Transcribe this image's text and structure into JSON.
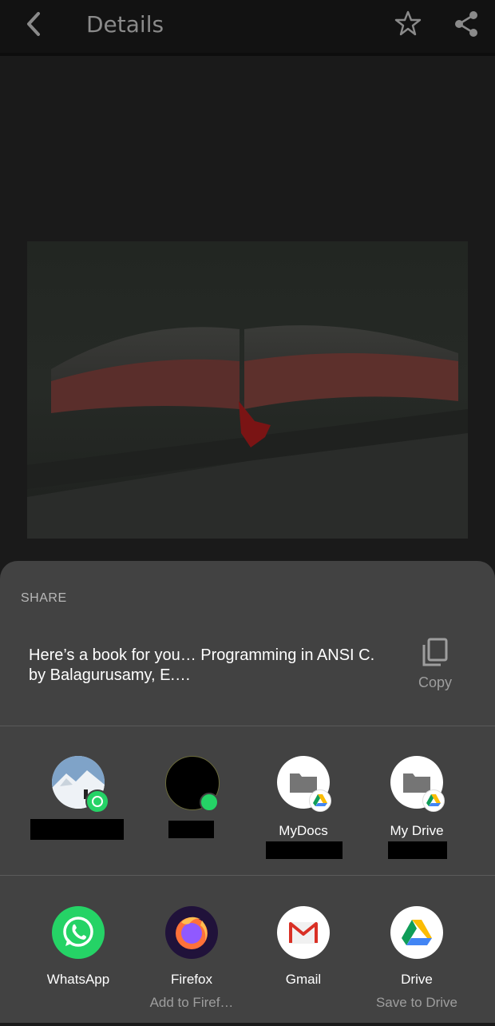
{
  "toolbar": {
    "title": "Details"
  },
  "share": {
    "label": "SHARE",
    "text": "Here’s a book for you… Programming in ANSI C. by Balagurusamy, E.…",
    "copy_label": "Copy"
  },
  "direct_targets": [
    {
      "label": ""
    },
    {
      "label": ""
    },
    {
      "label": "MyDocs"
    },
    {
      "label": "My Drive"
    }
  ],
  "apps": [
    {
      "label": "WhatsApp",
      "sub": ""
    },
    {
      "label": "Firefox",
      "sub": "Add to Firef…"
    },
    {
      "label": "Gmail",
      "sub": ""
    },
    {
      "label": "Drive",
      "sub": "Save to Drive"
    }
  ],
  "colors": {
    "sheet": "#424242",
    "whatsapp": "#25D366",
    "drive_yellow": "#FBBC04",
    "drive_green": "#0F9D58",
    "drive_blue": "#4285F4",
    "gmail_red": "#D93025"
  }
}
